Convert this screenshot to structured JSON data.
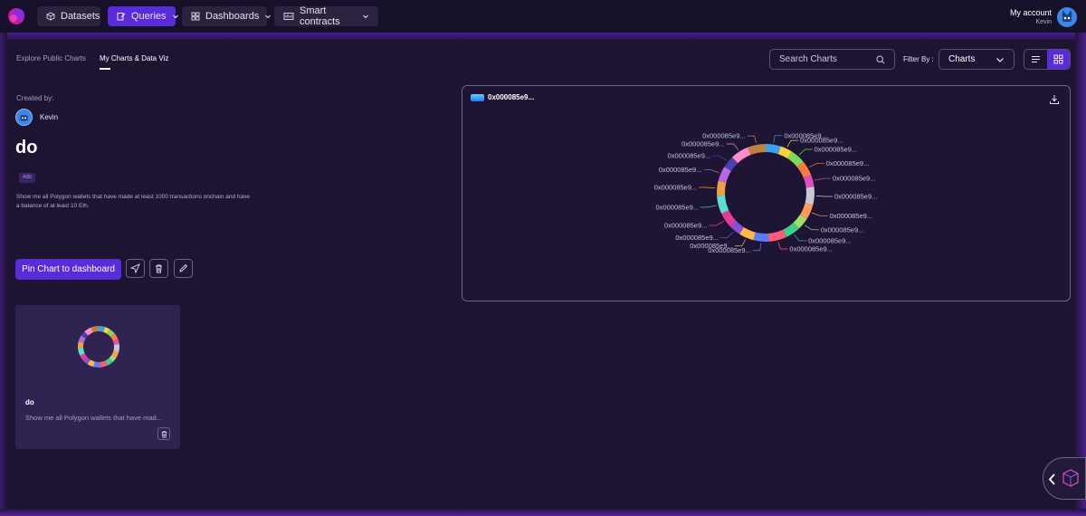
{
  "nav": {
    "datasets": "Datasets",
    "queries": "Queries",
    "dashboards": "Dashboards",
    "smart_contracts": "Smart contracts",
    "account_label": "My account",
    "account_user": "Kevin"
  },
  "tabs": {
    "explore": "Explore Public Charts",
    "my_charts": "My Charts & Data Viz"
  },
  "toolbar": {
    "search_placeholder": "Search Charts",
    "filter_label": "Filter By :",
    "filter_value": "Charts"
  },
  "details": {
    "created_by_label": "Created by:",
    "creator": "Kevin",
    "title": "do",
    "tag": "#do",
    "description": "Show me all Polygon wallets that have made at least 1000 transactions onchain and have a balance of at least 10 Eth.",
    "pin_button": "Pin Chart to dashboard"
  },
  "chart_panel": {
    "title": "0x000085e9..."
  },
  "chart_data": {
    "type": "pie",
    "title": "",
    "categories": [
      "0x000085e9...",
      "0x000085e9...",
      "0x000085e9...",
      "0x000085e9...",
      "0x000085e9...",
      "0x000085e9...",
      "0x000085e9...",
      "0x000085e9...",
      "0x000085e9...",
      "0x000085e9...",
      "0x000085e9...",
      "0x000085e9...",
      "0x000085e9...",
      "0x000085e9...",
      "0x000085e9...",
      "0x000085e9...",
      "0x000085e9...",
      "0x000085e9...",
      "0x000085e9...",
      "0x000085e9..."
    ],
    "values": [
      5,
      4,
      5,
      5,
      4,
      6,
      5,
      4,
      5,
      6,
      5,
      5,
      4,
      5,
      6,
      5,
      5,
      4,
      6,
      6
    ],
    "colors": [
      "#3aa0f0",
      "#ffd23c",
      "#7ed957",
      "#ff7a3c",
      "#e04ec0",
      "#c8c8d2",
      "#ff9a5a",
      "#9fe06a",
      "#3ccf8e",
      "#ff5c7a",
      "#5a7cff",
      "#ffb84a",
      "#8a4fd8",
      "#e63a9a",
      "#5be0d0",
      "#f0a040",
      "#b56be0",
      "#4a3fb0",
      "#ff8cc8",
      "#c08040"
    ],
    "donut": true
  },
  "card": {
    "title": "do",
    "description": "Show me all Polygon wallets that have mad..."
  },
  "icons": {
    "search": "search-icon",
    "chevron": "chevron-down-icon",
    "list_view": "list-view-icon",
    "grid_view": "grid-view-icon",
    "send": "send-icon",
    "delete": "trash-icon",
    "edit": "pencil-icon",
    "download": "download-icon"
  },
  "colors": {
    "accent": "#5a2bd8",
    "background": "#1c1431",
    "topbar": "#16102a"
  }
}
